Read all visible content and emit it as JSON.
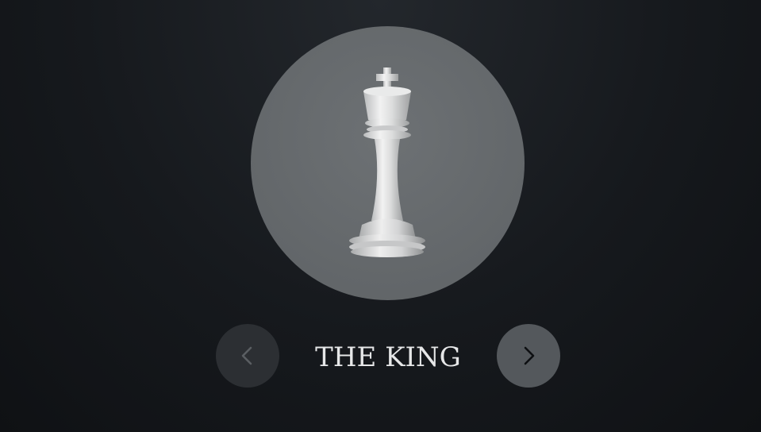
{
  "piece": {
    "name": "THE KING",
    "icon": "chess-king-icon"
  },
  "navigation": {
    "prev_icon": "chevron-left-icon",
    "next_icon": "chevron-right-icon"
  },
  "colors": {
    "background": "#16191d",
    "disc": "#64686b",
    "prev_button": "#2c2f33",
    "next_button": "#54585c",
    "title_text": "#e6e7e8"
  }
}
